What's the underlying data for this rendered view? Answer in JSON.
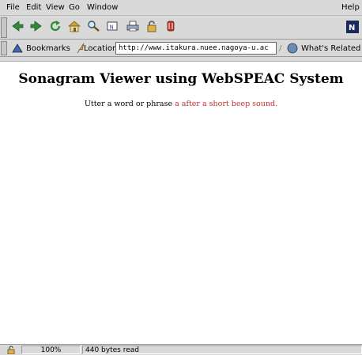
{
  "menu": {
    "file": "File",
    "edit": "Edit",
    "view": "View",
    "go": "Go",
    "window": "Window",
    "help": "Help"
  },
  "toolbar": {
    "icons": [
      "back-icon",
      "forward-icon",
      "reload-icon",
      "home-icon",
      "search-icon",
      "netscape-icon",
      "print-icon",
      "security-icon",
      "stop-icon",
      "throbber-logo"
    ]
  },
  "location_bar": {
    "bookmarks_label": "Bookmarks",
    "location_label": "Location:",
    "url": "http://www.itakura.nuee.nagoya-u.ac",
    "whats_related_label": "What's Related"
  },
  "page": {
    "title": "Sonagram Viewer using WebSPEAC System",
    "instruction_black": "Utter a word or phrase ",
    "instruction_red": "a after a short beep sound."
  },
  "status_bar": {
    "zoom": "100%",
    "message": "440 bytes read"
  },
  "colors": {
    "chrome": "#d9d9d9",
    "instruction_red": "#c0302a"
  }
}
